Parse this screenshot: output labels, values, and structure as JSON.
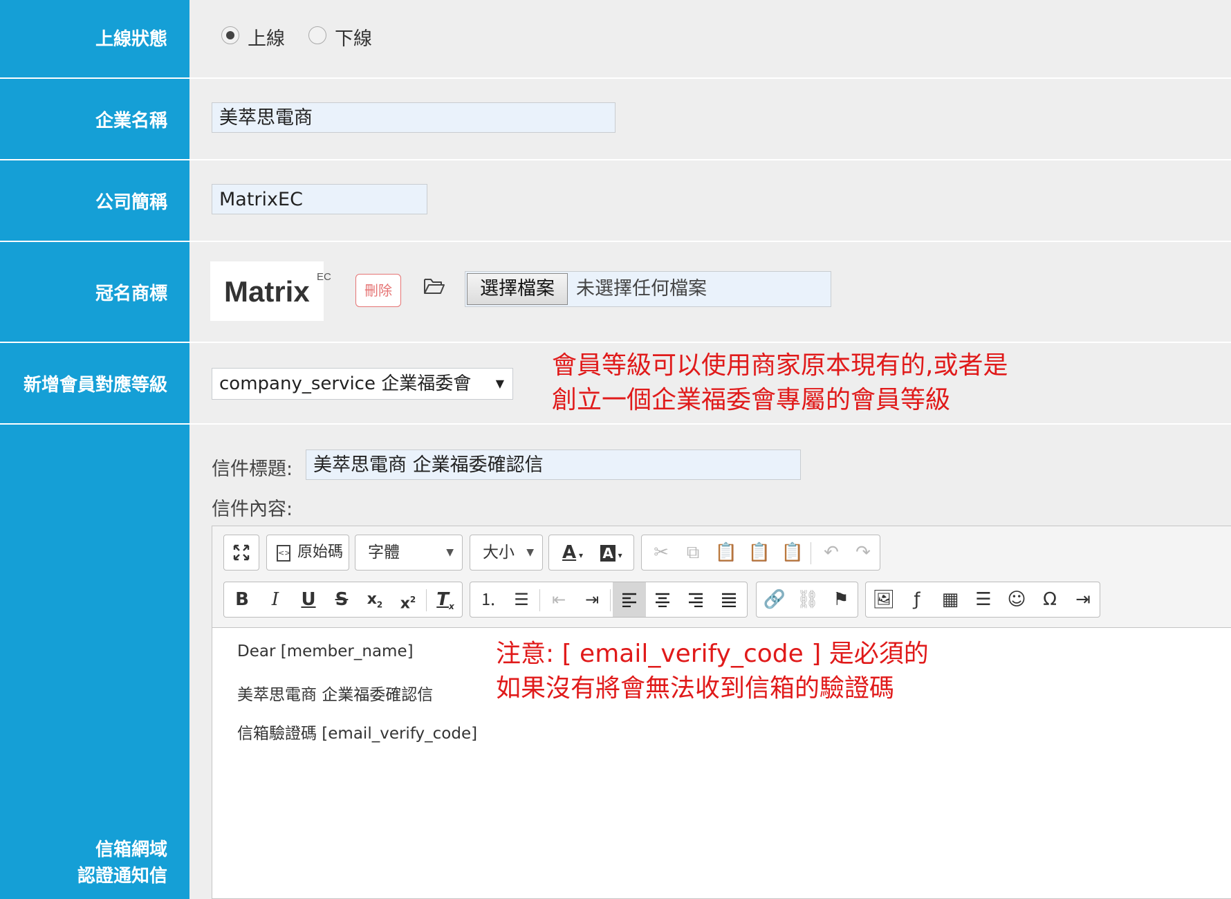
{
  "fields": {
    "status": {
      "label": "上線狀態",
      "options": [
        "上線",
        "下線"
      ],
      "selected": "上線"
    },
    "company_name": {
      "label": "企業名稱",
      "value": "美萃思電商"
    },
    "short_name": {
      "label": "公司簡稱",
      "value": "MatrixEC"
    },
    "logo": {
      "label": "冠名商標",
      "logo_text": "Matrix",
      "logo_sup": "EC",
      "delete_label": "刪除",
      "choose_file_label": "選擇檔案",
      "no_file_text": "未選擇任何檔案"
    },
    "member_level": {
      "label": "新增會員對應等級",
      "selected": "company_service 企業福委會"
    },
    "email_domain": {
      "label_line1": "信箱網域",
      "label_line2": "認證通知信"
    }
  },
  "email": {
    "subject_label": "信件標題:",
    "subject_value": "美萃思電商 企業福委確認信",
    "content_label": "信件內容:",
    "body_lines": [
      "Dear [member_name]",
      "美萃思電商 企業福委確認信",
      "信箱驗證碼 [email_verify_code]"
    ]
  },
  "toolbar": {
    "source_label": "原始碼",
    "font_label": "字體",
    "size_label": "大小"
  },
  "annotations": {
    "level_note_line1": "會員等級可以使用商家原本現有的,或者是",
    "level_note_line2": "創立一個企業福委會專屬的會員等級",
    "code_note_line1": "注意: [ email_verify_code ] 是必須的",
    "code_note_line2": "如果沒有將會無法收到信箱的驗證碼"
  },
  "colors": {
    "label_bg": "#159fd6",
    "annotation": "#e01a1a"
  }
}
